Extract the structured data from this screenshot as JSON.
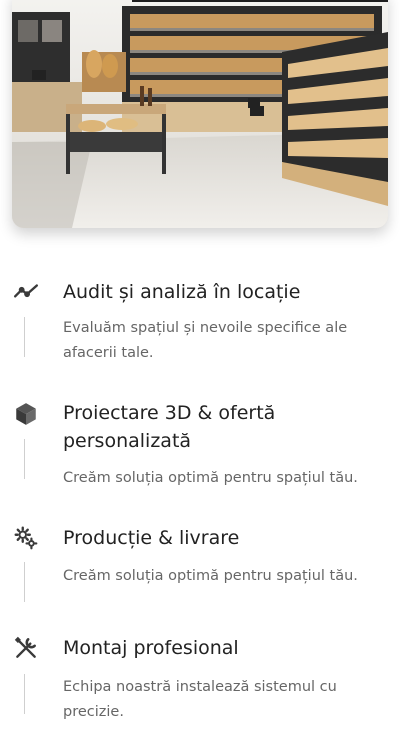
{
  "hero_image": {
    "alt": "bakery-shop-interior"
  },
  "steps": [
    {
      "icon": "trend-line-icon",
      "title": "Audit și analiză în locație",
      "description": "Evaluăm spațiul și nevoile specifice ale afacerii tale."
    },
    {
      "icon": "cube-icon",
      "title": "Proiectare 3D & ofertă personalizată",
      "description": "Creăm soluția optimă pentru spațiul tău."
    },
    {
      "icon": "gears-icon",
      "title": "Producție & livrare",
      "description": "Creăm soluția optimă pentru spațiul tău."
    },
    {
      "icon": "tools-icon",
      "title": "Montaj profesional",
      "description": "Echipa noastră instalează sistemul cu precizie."
    }
  ]
}
